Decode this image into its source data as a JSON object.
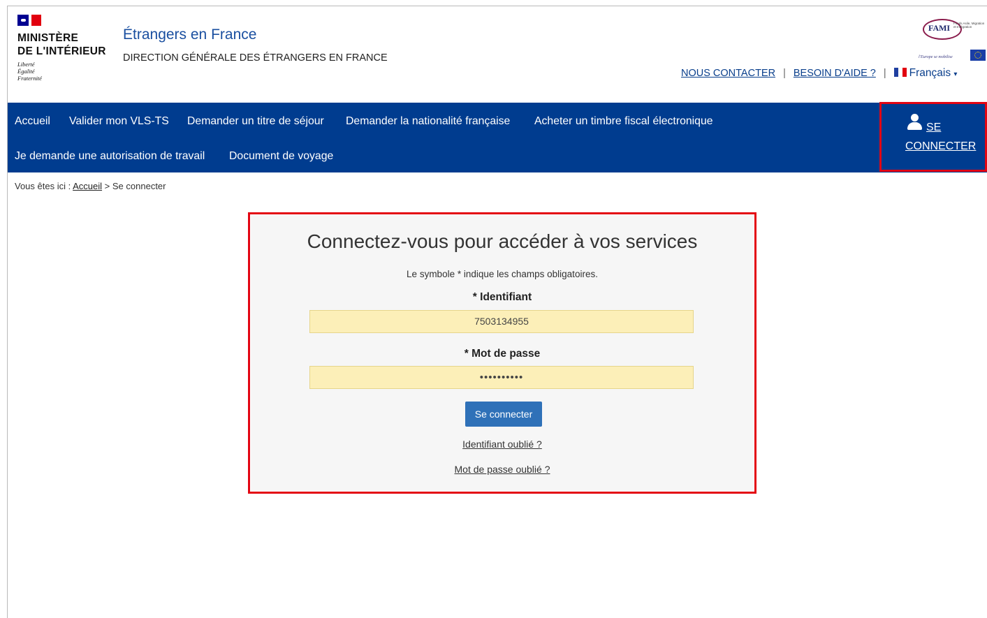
{
  "header": {
    "ministry_line1": "MINISTÈRE",
    "ministry_line2": "DE L'INTÉRIEUR",
    "devise": [
      "Liberté",
      "Égalité",
      "Fraternité"
    ],
    "site_title": "Étrangers en France",
    "site_subtitle": "DIRECTION GÉNÉRALE DES ÉTRANGERS EN FRANCE",
    "partner_logo": {
      "name": "FAMI",
      "tagline": "l'Europe se mobilise",
      "small_text": "Fonds Asile, Migration et Intégration"
    },
    "links": {
      "contact": "NOUS CONTACTER",
      "help": "BESOIN D'AIDE ?",
      "language": "Français"
    }
  },
  "nav": {
    "items": [
      "Accueil",
      "Valider mon VLS-TS",
      "Demander un titre de séjour",
      "Demander la nationalité française",
      "Acheter un timbre fiscal électronique",
      "Je demande une autorisation de travail",
      "Document de voyage"
    ],
    "connect_line1": "SE",
    "connect_line2": "CONNECTER"
  },
  "breadcrumb": {
    "prefix": "Vous êtes ici :",
    "home": "Accueil",
    "separator": ">",
    "current": "Se connecter"
  },
  "login": {
    "title": "Connectez-vous pour accéder à vos services",
    "required_note": "Le symbole * indique les champs obligatoires.",
    "identifier_label": "* Identifiant",
    "identifier_value": "7503134955",
    "password_label": "* Mot de passe",
    "password_value": "••••••••••",
    "submit_label": "Se connecter",
    "forgot_identifier": "Identifiant oublié ?",
    "forgot_password": "Mot de passe oublié ?"
  },
  "colors": {
    "nav_bg": "#003c8f",
    "highlight_outline": "#e30613",
    "field_bg": "#fcefb8",
    "button_bg": "#2f71b8"
  }
}
